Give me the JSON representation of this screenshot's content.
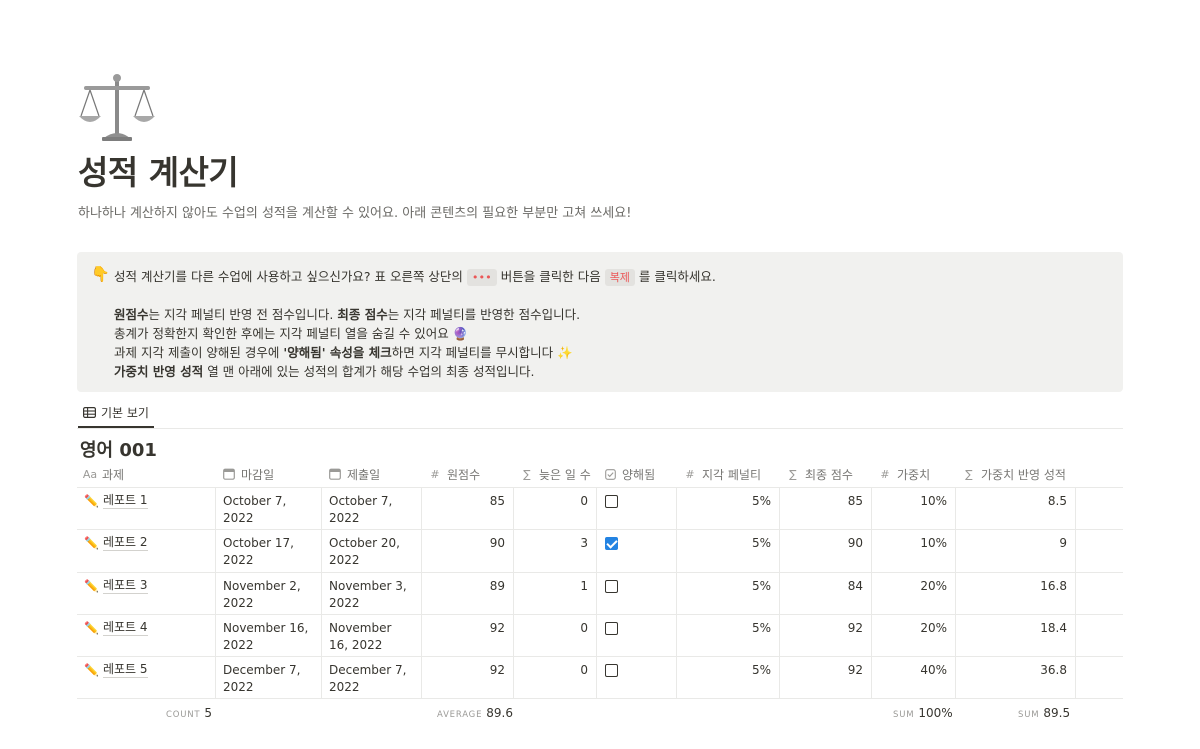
{
  "page": {
    "icon": "balance-scale-icon",
    "title": "성적 계산기",
    "description": "하나하나 계산하지 않아도 수업의 성적을 계산할 수 있어요. 아래 콘텐츠의 필요한 부분만 고쳐 쓰세요!"
  },
  "callout": {
    "icon": "👇",
    "line1_a": "성적 계산기를 다른 수업에 사용하고 싶으신가요? 표 오른쪽 상단의 ",
    "line1_chip1": "•••",
    "line1_b": " 버튼을 클릭한 다음 ",
    "line1_chip2": "복제",
    "line1_c": " 를 클릭하세요.",
    "line2_b1": "원점수",
    "line2_a": "는 지각 페널티 반영 전 점수입니다. ",
    "line2_b2": "최종 점수",
    "line2_c": "는 지각 페널티를 반영한 점수입니다.",
    "line3": "총계가 정확한지 확인한 후에는 지각 페널티 열을 숨길 수 있어요 🔮",
    "line4_a": "과제 지각 제출이 양해된 경우에 ",
    "line4_b": "'양해됨' 속성을 체크",
    "line4_c": "하면 지각 페널티를 무시합니다 ✨",
    "line5_b": "가중치 반영 성적",
    "line5_a": " 열 맨 아래에 있는 성적의 합계가 해당 수업의 최종 성적입니다."
  },
  "view": {
    "tab_label": "기본 보기"
  },
  "database": {
    "title": "영어 001",
    "columns": {
      "name": {
        "icon": "Aa",
        "label": "과제"
      },
      "due": {
        "icon": "calendar-icon",
        "label": "마감일"
      },
      "submitted": {
        "icon": "calendar-icon",
        "label": "제출일"
      },
      "raw": {
        "icon": "#",
        "label": "원점수"
      },
      "days_late": {
        "icon": "∑",
        "label": "늦은 일 수"
      },
      "excused": {
        "icon": "checkbox-icon",
        "label": "양해됨"
      },
      "penalty": {
        "icon": "#",
        "label": "지각 페널티"
      },
      "final": {
        "icon": "∑",
        "label": "최종 점수"
      },
      "weight": {
        "icon": "#",
        "label": "가중치"
      },
      "weighted": {
        "icon": "∑",
        "label": "가중치 반영 성적"
      }
    },
    "rows": [
      {
        "name": "레포트 1",
        "due": "October 7, 2022",
        "submitted": "October 7, 2022",
        "raw": "85",
        "days_late": "0",
        "excused": false,
        "penalty": "5%",
        "final": "85",
        "weight": "10%",
        "weighted": "8.5"
      },
      {
        "name": "레포트 2",
        "due": "October 17, 2022",
        "submitted": "October 20, 2022",
        "raw": "90",
        "days_late": "3",
        "excused": true,
        "penalty": "5%",
        "final": "90",
        "weight": "10%",
        "weighted": "9"
      },
      {
        "name": "레포트 3",
        "due": "November 2, 2022",
        "submitted": "November 3, 2022",
        "raw": "89",
        "days_late": "1",
        "excused": false,
        "penalty": "5%",
        "final": "84",
        "weight": "20%",
        "weighted": "16.8"
      },
      {
        "name": "레포트 4",
        "due": "November 16, 2022",
        "submitted": "November 16, 2022",
        "raw": "92",
        "days_late": "0",
        "excused": false,
        "penalty": "5%",
        "final": "92",
        "weight": "20%",
        "weighted": "18.4"
      },
      {
        "name": "레포트 5",
        "due": "December 7, 2022",
        "submitted": "December 7, 2022",
        "raw": "92",
        "days_late": "0",
        "excused": false,
        "penalty": "5%",
        "final": "92",
        "weight": "40%",
        "weighted": "36.8"
      }
    ],
    "aggregates": {
      "count_label": "COUNT",
      "count_value": "5",
      "raw_label": "AVERAGE",
      "raw_value": "89.6",
      "weight_label": "SUM",
      "weight_value": "100%",
      "weighted_label": "SUM",
      "weighted_value": "89.5"
    }
  },
  "colors": {
    "text": "#37352f",
    "muted": "#787774",
    "callout_bg": "#f1f1ef",
    "checkbox_checked": "#2383e2",
    "border": "#e9e9e7"
  }
}
